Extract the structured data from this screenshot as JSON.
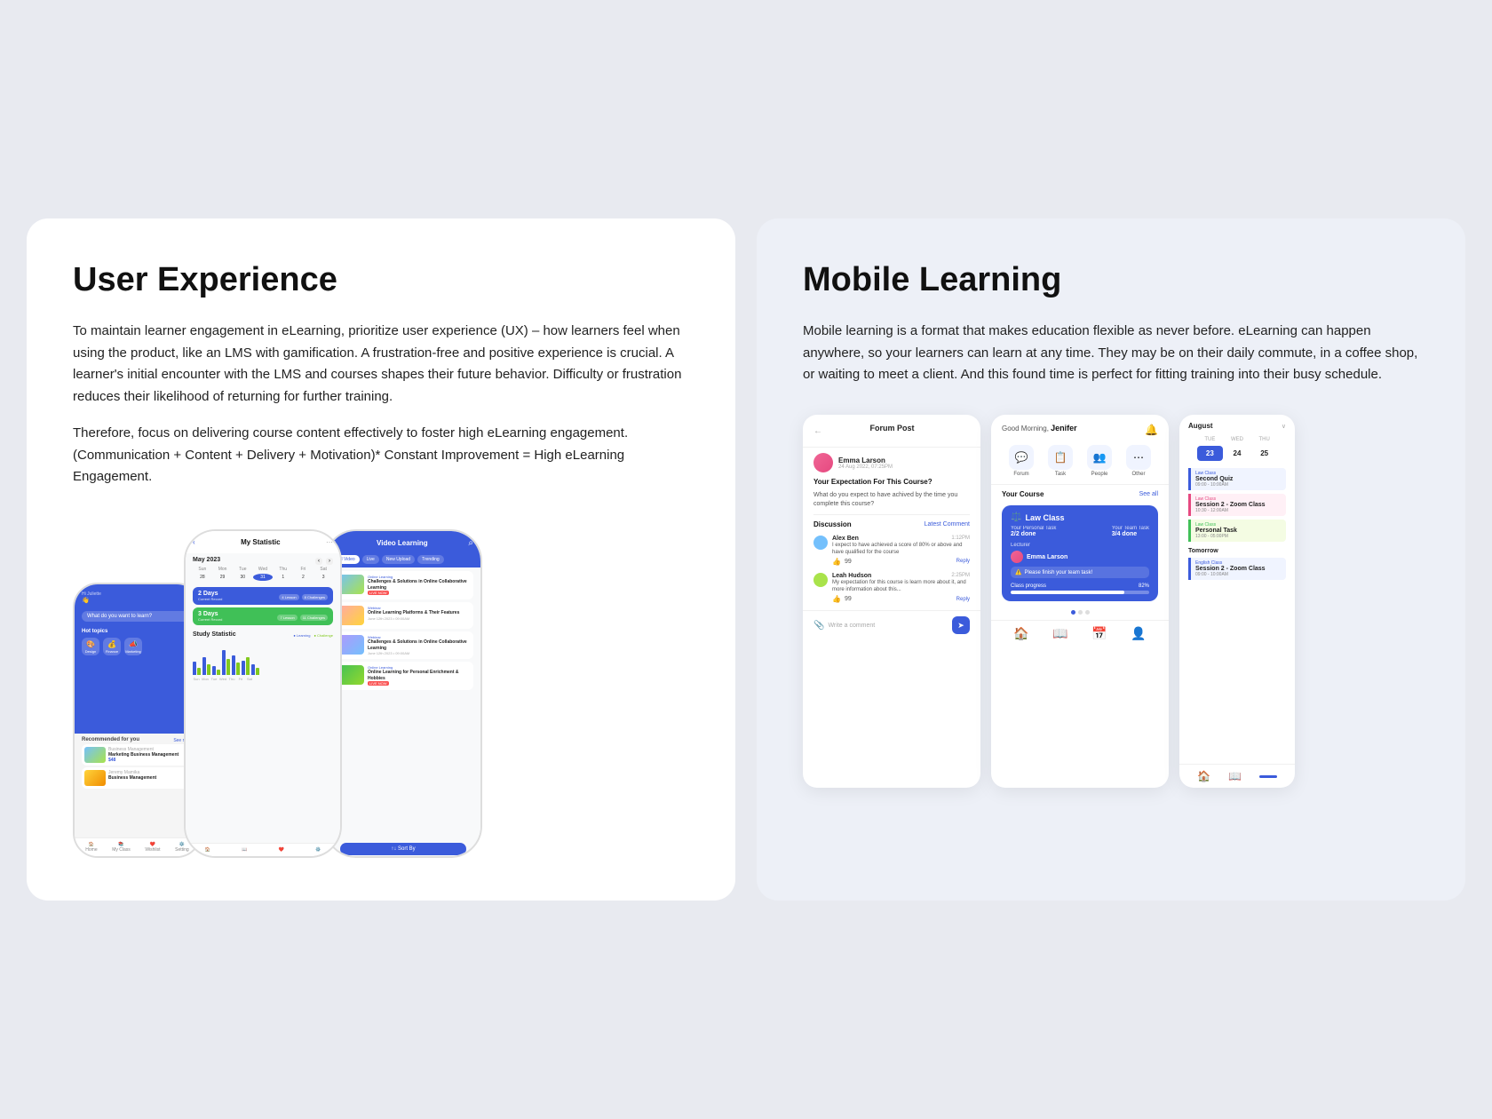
{
  "left_panel": {
    "title": "User Experience",
    "body1": "To maintain learner engagement in eLearning, prioritize user experience (UX) – how learners feel when using the product, like an LMS with gamification. A frustration-free and positive experience is crucial. A learner's initial encounter with the LMS and courses shapes their future behavior. Difficulty or frustration reduces their likelihood of returning for further training.",
    "body2": "Therefore, focus on delivering course content effectively to foster high eLearning engagement. (Communication + Content + Delivery + Motivation)* Constant Improvement = High eLearning Engagement.",
    "phone1": {
      "user": "Hi Juliette",
      "search_placeholder": "What do you want to learn?",
      "section_hot": "Hot topics",
      "see_more": "See more",
      "icons": [
        "Design",
        "Finance",
        "Marketing"
      ],
      "section_recommended": "Recommended for you",
      "nav_items": [
        "Home",
        "My Class",
        "Wishlist",
        "Setting"
      ],
      "product": "Marketing Business Management",
      "price": "$48"
    },
    "phone2": {
      "title": "My Statistic",
      "month": "May 2023",
      "days_labels": [
        "Sun",
        "Mon",
        "Tue",
        "Wed",
        "Thu",
        "Fri",
        "Sat"
      ],
      "record1": {
        "days": "2 Days",
        "sub": "Current Record",
        "lesson": "4 Lesson",
        "challenges": "8 Challenges"
      },
      "record2": {
        "days": "3 Days",
        "sub": "Current Record",
        "lesson": "7 Lesson",
        "challenges": "11 Challenges"
      },
      "stat_title": "Study Statistic",
      "legend_learning": "Learning",
      "legend_challenge": "Challenge"
    },
    "phone3": {
      "title": "Video Learning",
      "filters": [
        "All Video",
        "Live",
        "New Upload",
        "Trending"
      ],
      "items": [
        {
          "category": "Online Learning",
          "title": "Challenges & Solutions in Online Collaborative Learning",
          "badge": "LIVE NOW",
          "date": ""
        },
        {
          "category": "Webinar",
          "title": "Online Learning Platforms & Their Features",
          "badge": "",
          "date": "June 12th 2023 • 09:00AM"
        },
        {
          "category": "Webinar",
          "title": "Challenges & Solutions in Online Collaborative Learning",
          "badge": "",
          "date": "June 12th 2023 • 09:00AM"
        },
        {
          "category": "Online Learning",
          "title": "Online Learning for Personal Enrichment & Hobbies",
          "badge": "LIVE NOW",
          "date": ""
        }
      ],
      "sort_btn": "↑↓ Sort By"
    }
  },
  "right_panel": {
    "title": "Mobile Learning",
    "body": "Mobile learning is a format that makes education flexible as never before. eLearning can happen anywhere, so your learners can learn at any time. They may be on their daily commute, in a coffee shop, or waiting to meet a client. And this found time is perfect for fitting training into their busy schedule.",
    "forum": {
      "back": "←",
      "title": "Forum Post",
      "user_name": "Emma Larson",
      "user_time": "24 Aug 2022, 07:25PM",
      "question": "Your Expectation For This Course?",
      "desc": "What do you expect to have achived by the time you complete this course?",
      "discussion_label": "Discussion",
      "latest_label": "Latest Comment",
      "comments": [
        {
          "name": "Alex Ben",
          "time": "1:12PM",
          "text": "I expect to have achieved a score of 80% or above and have qualified for the course",
          "likes": 99
        },
        {
          "name": "Leah Hudson",
          "time": "2:25PM",
          "text": "My expectation for this course is learn more about it, and more information about this...",
          "likes": 99
        }
      ],
      "input_placeholder": "Write a comment",
      "reply_label": "Reply"
    },
    "dashboard": {
      "greeting": "Good Morning,",
      "name": "Jenifer",
      "nav_items": [
        "Forum",
        "Task",
        "People",
        "Other"
      ],
      "course_label": "Your Course",
      "see_all": "See all",
      "course": {
        "title": "Law Class",
        "icon": "⚖️",
        "personal_task_label": "Your Personal Task",
        "personal_task_val": "2/2 done",
        "team_task_label": "Your Team Task",
        "team_task_val": "3/4 done",
        "lecturer_label": "Lecturer",
        "lecturer_name": "Emma Larson",
        "alert": "Please finish your team task!",
        "progress_label": "Class progress",
        "progress_val": "82%",
        "progress_pct": 82
      },
      "bottom_nav": [
        "🏠",
        "📖",
        "📅",
        "👤"
      ]
    },
    "calendar": {
      "month": "August",
      "days_header": [
        "TUE",
        "WED",
        "THU"
      ],
      "dates": [
        23,
        24,
        25
      ],
      "today": 23,
      "section_label": "Tomorrow",
      "events": [
        {
          "category": "Law Class",
          "title": "Second Quiz",
          "time": "09:00 - 10:00AM",
          "color": "blue"
        },
        {
          "category": "Law Class",
          "title": "Session 2 - Zoom Class",
          "time": "10:30 - 12:00AM",
          "color": "pink"
        },
        {
          "category": "Law Class",
          "title": "Personal Task",
          "time": "13:00 - 05:00PM",
          "color": "green"
        }
      ],
      "tomorrow_events": [
        {
          "category": "English Class",
          "title": "Session 2 - Zoom Class",
          "time": "09:00 - 10:00AM",
          "color": "blue"
        }
      ]
    }
  },
  "colors": {
    "accent": "#3b5bdb",
    "white": "#ffffff",
    "bg_left": "#ffffff",
    "bg_right": "#edf0f7"
  }
}
